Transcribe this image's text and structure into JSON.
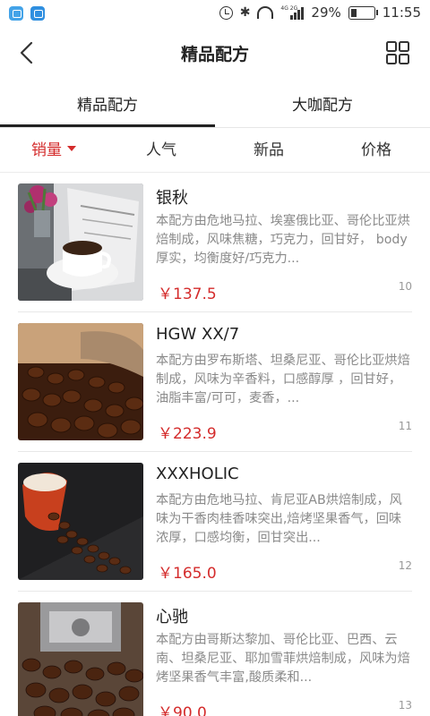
{
  "status_bar": {
    "battery": "29%",
    "time": "11:55",
    "battery_level": 0.29,
    "network_label": "4G 2G"
  },
  "header": {
    "title": "精品配方"
  },
  "tabs": [
    {
      "label": "精品配方",
      "active": true
    },
    {
      "label": "大咖配方",
      "active": false
    }
  ],
  "sort": [
    {
      "label": "销量",
      "active": true
    },
    {
      "label": "人气",
      "active": false
    },
    {
      "label": "新品",
      "active": false
    },
    {
      "label": "价格",
      "active": false
    }
  ],
  "items": [
    {
      "name": "银秋",
      "description": "本配方由危地马拉、埃塞俄比亚、哥伦比亚烘焙制成，风味焦糖，巧克力，回甘好， body 厚实，均衡度好/巧克力...",
      "price": "￥137.5",
      "count": "10",
      "image": "coffee-cup-magazine"
    },
    {
      "name": "HGW XX/7",
      "description": "本配方由罗布斯塔、坦桑尼亚、哥伦比亚烘焙制成，风味为辛香料，口感醇厚 ，回甘好， 油脂丰富/可可，麦香，...",
      "price": "￥223.9",
      "count": "11",
      "image": "coffee-beans-scoop"
    },
    {
      "name": "XXXHOLIC",
      "description": "本配方由危地马拉、肯尼亚AB烘焙制成，风味为干香肉桂香味突出,焙烤坚果香气，回味浓厚，口感均衡，回甘突出...",
      "price": "￥165.0",
      "count": "12",
      "image": "red-cup-beans"
    },
    {
      "name": "心驰",
      "description": "本配方由哥斯达黎加、哥伦比亚、巴西、云南、坦桑尼亚、耶加雪菲烘焙制成，风味为焙烤坚果香气丰富,酸质柔和...",
      "price": "￥90.0",
      "count": "13",
      "image": "grinder-beans"
    }
  ],
  "colors": {
    "accent": "#d42b2b",
    "text": "#222222",
    "muted": "#8a8a8a"
  }
}
